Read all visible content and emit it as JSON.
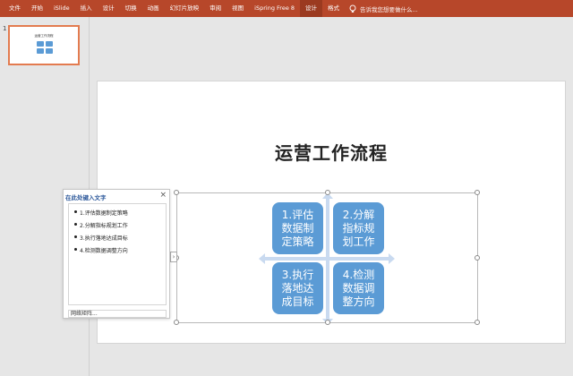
{
  "ribbon": {
    "tabs": [
      "文件",
      "开始",
      "iSlide",
      "插入",
      "设计",
      "切换",
      "动画",
      "幻灯片放映",
      "审阅",
      "视图",
      "iSpring Free 8",
      "设计",
      "格式"
    ],
    "active_tab_index": 11,
    "search_text": "告诉我您想要做什么...",
    "color": "#b7472a"
  },
  "thumbnails": {
    "slide_number": "1",
    "selected_border_color": "#e37b4f"
  },
  "slide": {
    "title": "运营工作流程",
    "smartart": {
      "box_color": "#5b9bd5",
      "arrow_color": "#c9daf0",
      "boxes": [
        "1.评估数据制定策略",
        "2.分解指标规划工作",
        "3.执行落地达成目标",
        "4.检测数据调整方向"
      ]
    }
  },
  "text_pane": {
    "title": "在此处键入文字",
    "close_glyph": "×",
    "items": [
      "1.评估数据制定策略",
      "2.分解指标规划工作",
      "3.执行落地达成目标",
      "4.检测数据调整方向"
    ],
    "footer": "网络矩阵..."
  }
}
